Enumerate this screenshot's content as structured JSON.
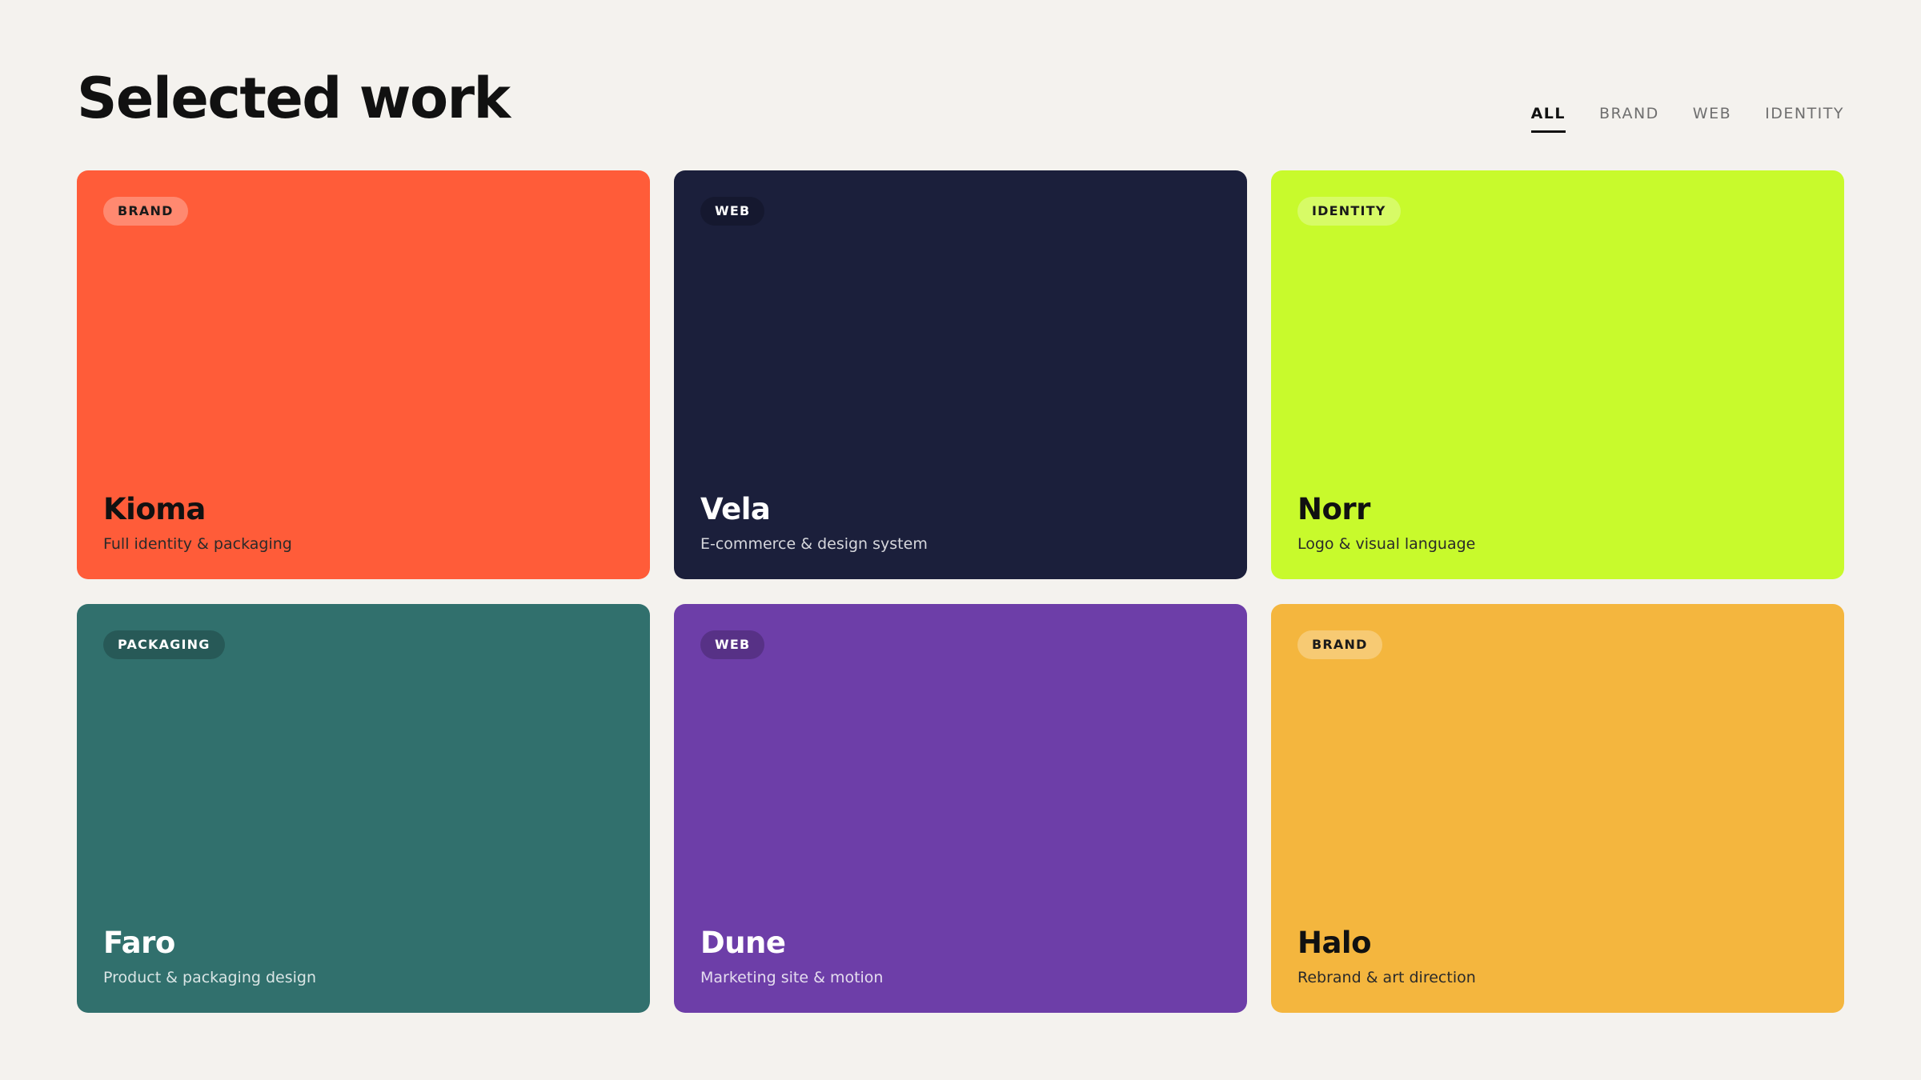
{
  "header": {
    "title": "Selected work"
  },
  "filters": [
    {
      "label": "ALL"
    },
    {
      "label": "BRAND"
    },
    {
      "label": "WEB"
    },
    {
      "label": "IDENTITY"
    }
  ],
  "projects": [
    {
      "tag": "BRAND",
      "title": "Kioma",
      "description": "Full identity & packaging",
      "color": "#ff5c39",
      "tone": "light"
    },
    {
      "tag": "WEB",
      "title": "Vela",
      "description": "E-commerce & design system",
      "color": "#1b1f3b",
      "tone": "dark"
    },
    {
      "tag": "IDENTITY",
      "title": "Norr",
      "description": "Logo & visual language",
      "color": "#c8fa2c",
      "tone": "light"
    },
    {
      "tag": "PACKAGING",
      "title": "Faro",
      "description": "Product & packaging design",
      "color": "#31706d",
      "tone": "dark"
    },
    {
      "tag": "WEB",
      "title": "Dune",
      "description": "Marketing site & motion",
      "color": "#6d3ea8",
      "tone": "dark"
    },
    {
      "tag": "BRAND",
      "title": "Halo",
      "description": "Rebrand & art direction",
      "color": "#f4b63e",
      "tone": "light"
    }
  ]
}
